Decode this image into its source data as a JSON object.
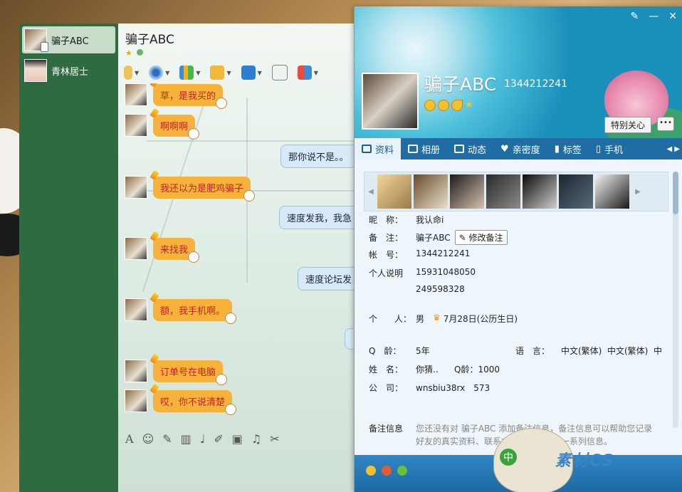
{
  "contacts": [
    {
      "name": "骗子ABC",
      "active": true
    },
    {
      "name": "青林居士",
      "active": false
    }
  ],
  "chat": {
    "title": "骗子ABC",
    "messages_in": [
      {
        "text": "草，是我买的"
      },
      {
        "text": "啊啊啊"
      },
      {
        "text": "我还以为是肥鸡骗子"
      },
      {
        "text": "来找我"
      },
      {
        "text": "额，我手机啊。"
      },
      {
        "text": "订单号在电脑"
      },
      {
        "text": "哎，你不说清楚"
      }
    ],
    "messages_out": [
      {
        "text": "那你说不是。。"
      },
      {
        "text": "速度发我，我急"
      },
      {
        "text": "速度论坛发"
      }
    ]
  },
  "profile": {
    "name": "骗子ABC",
    "qq": "1344212241",
    "special_btn": "特别关心",
    "tabs": [
      "资料",
      "相册",
      "动态",
      "亲密度",
      "标签",
      "手机"
    ],
    "nickname_label": "昵　称：",
    "nickname": "我认命i",
    "remark_label": "备　注：",
    "remark": "骗子ABC",
    "edit_remark": "修改备注",
    "account_label": "帐　号：",
    "account": "1344212241",
    "bio_label": "个人说明",
    "bio_line1": "15931048050",
    "bio_line2": "249598328",
    "personal_label": "个　　人：",
    "gender": "男",
    "birthday": "7月28日(公历生日)",
    "qage_label": "Q　龄：",
    "qage": "5年",
    "lang_label": "语　言：",
    "lang": "中文(繁体)  中文(繁体)  中",
    "fullname_label": "姓　名：",
    "fullname": "你猜..",
    "qage2": "Q龄：1000",
    "company_label": "公　司：",
    "company": "wnsbiu38rx　573",
    "note_label": "备注信息",
    "note_text": "您还没有对 骗子ABC 添加备注信息，备注信息可以帮助您记录好友的真实资料、联系方式、事件的等一系列信息。",
    "mascot_label": "中",
    "watermark": "素材CS"
  }
}
